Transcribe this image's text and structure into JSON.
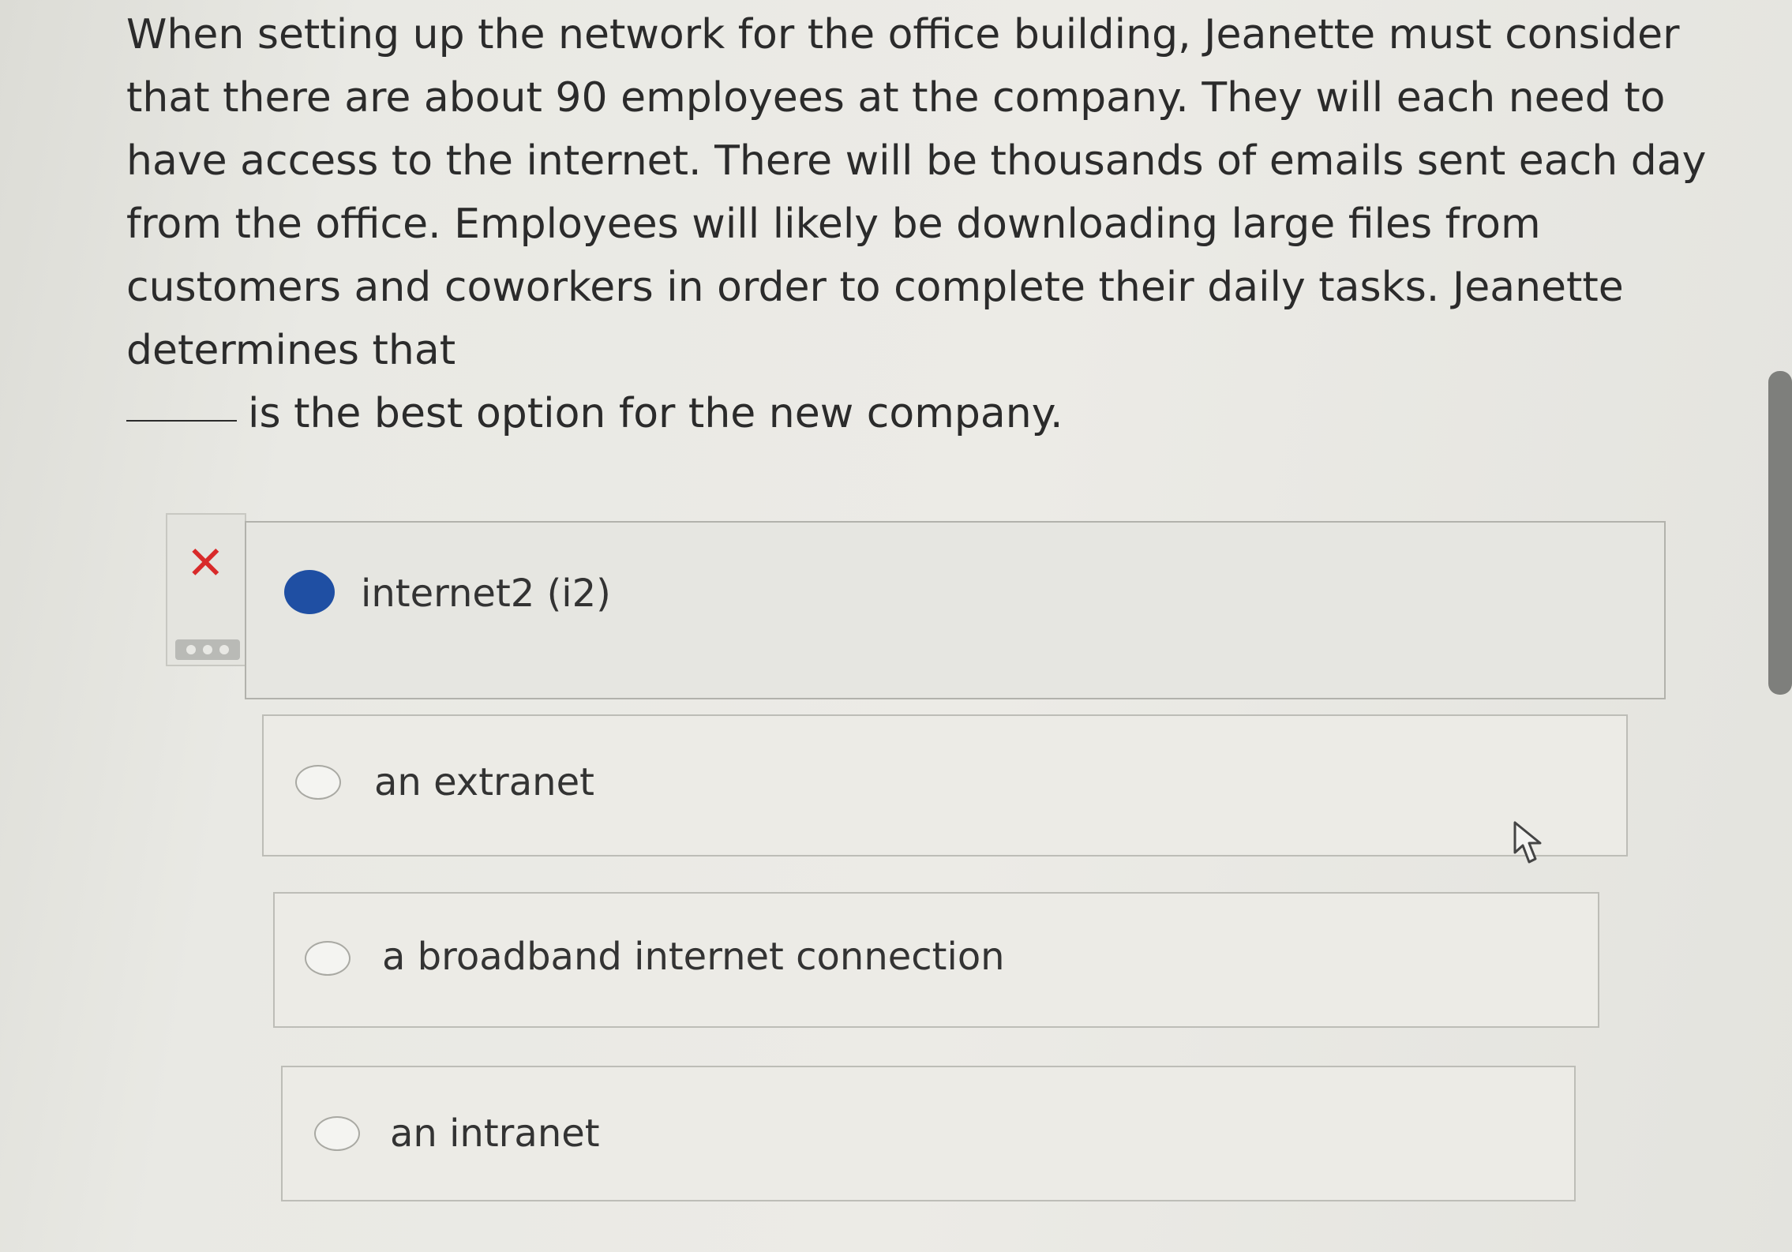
{
  "question": {
    "text_before_blank": "When setting up the network for the office building, Jeanette must consider that there are about 90 employees at the company. They will each need to have access to the internet. There will be thousands of emails sent each day from the office. Employees will likely be downloading large files from customers and coworkers in order to complete their daily tasks. Jeanette determines that",
    "text_after_blank": "is the best option for the new company."
  },
  "feedback": {
    "status_icon": "x-icon",
    "status_color": "#d82a2a",
    "status_glyph": "✕",
    "more_icon": "ellipsis-icon"
  },
  "options": [
    {
      "label": "internet2 (i2)",
      "selected": true
    },
    {
      "label": "an extranet",
      "selected": false
    },
    {
      "label": "a broadband internet connection",
      "selected": false
    },
    {
      "label": "an intranet",
      "selected": false
    }
  ],
  "colors": {
    "selected_radio": "#1f4fa3",
    "incorrect": "#d82a2a"
  }
}
